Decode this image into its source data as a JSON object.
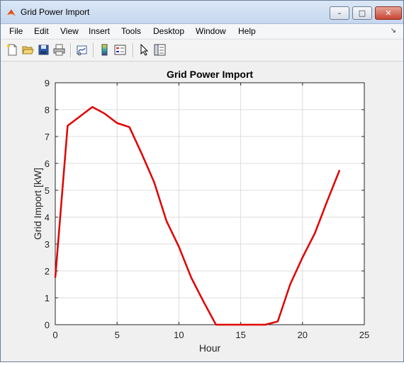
{
  "window": {
    "title": "Grid Power Import",
    "controls": {
      "minimize": "–",
      "maximize": "□",
      "close": "✕"
    }
  },
  "menu": {
    "items": [
      "File",
      "Edit",
      "View",
      "Insert",
      "Tools",
      "Desktop",
      "Window",
      "Help"
    ],
    "overflow_icon": "chevron-down-icon"
  },
  "toolbar": {
    "icons": [
      "new-figure-icon",
      "open-file-icon",
      "save-icon",
      "print-icon",
      "link-plot-icon",
      "insert-colorbar-icon",
      "insert-legend-icon",
      "pointer-icon",
      "property-editor-icon"
    ]
  },
  "chart_data": {
    "type": "line",
    "title": "Grid Power Import",
    "xlabel": "Hour",
    "ylabel": "Grid Import [kW]",
    "xlim": [
      0,
      25
    ],
    "ylim": [
      0,
      9
    ],
    "xticks": [
      0,
      5,
      10,
      15,
      20,
      25
    ],
    "yticks": [
      0,
      1,
      2,
      3,
      4,
      5,
      6,
      7,
      8,
      9
    ],
    "grid": true,
    "line_color": "#e00000",
    "series": [
      {
        "x": [
          0,
          1,
          2,
          3,
          4,
          5,
          6,
          7,
          8,
          9,
          10,
          11,
          12,
          13,
          14,
          15,
          16,
          17,
          18,
          19,
          20,
          21,
          22,
          23
        ],
        "values": [
          1.75,
          7.4,
          7.75,
          8.1,
          7.85,
          7.5,
          7.35,
          6.35,
          5.3,
          3.85,
          2.9,
          1.75,
          0.85,
          0.0,
          0.0,
          0.0,
          0.0,
          0.0,
          0.12,
          1.5,
          2.5,
          3.4,
          4.6,
          5.75
        ]
      }
    ]
  }
}
